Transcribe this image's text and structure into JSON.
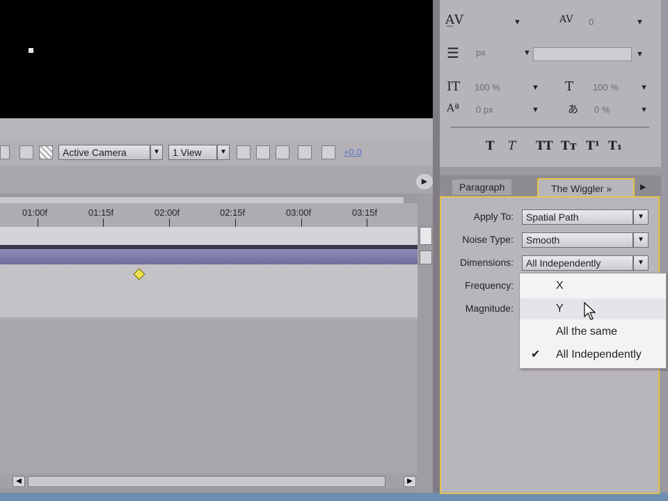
{
  "viewer_toolbar": {
    "camera_label": "Active Camera",
    "view_label": "1 View",
    "exposure_value": "+0.0"
  },
  "timeline": {
    "ruler_labels": [
      "01:00f",
      "01:15f",
      "02:00f",
      "02:15f",
      "03:00f",
      "03:15f"
    ]
  },
  "character_panel": {
    "tracking_value": "0",
    "leading_unit": "px",
    "vertical_scale": "100 %",
    "horizontal_scale": "100 %",
    "baseline_shift": "0 px",
    "tsume": "0 %"
  },
  "tabs": {
    "paragraph": "Paragraph",
    "wiggler": "The Wiggler",
    "wiggler_suffix": "»"
  },
  "wiggler": {
    "apply_to_label": "Apply To:",
    "apply_to_value": "Spatial Path",
    "noise_type_label": "Noise Type:",
    "noise_type_value": "Smooth",
    "dimensions_label": "Dimensions:",
    "dimensions_value": "All Independently",
    "frequency_label": "Frequency:",
    "magnitude_label": "Magnitude:"
  },
  "dimensions_menu": {
    "items": [
      "X",
      "Y",
      "All the same",
      "All Independently"
    ],
    "checked": "All Independently"
  },
  "colors": {
    "accent_outline": "#e3c44a",
    "keyframe": "#e9e14c",
    "layer_bar": "#7b78a8"
  }
}
